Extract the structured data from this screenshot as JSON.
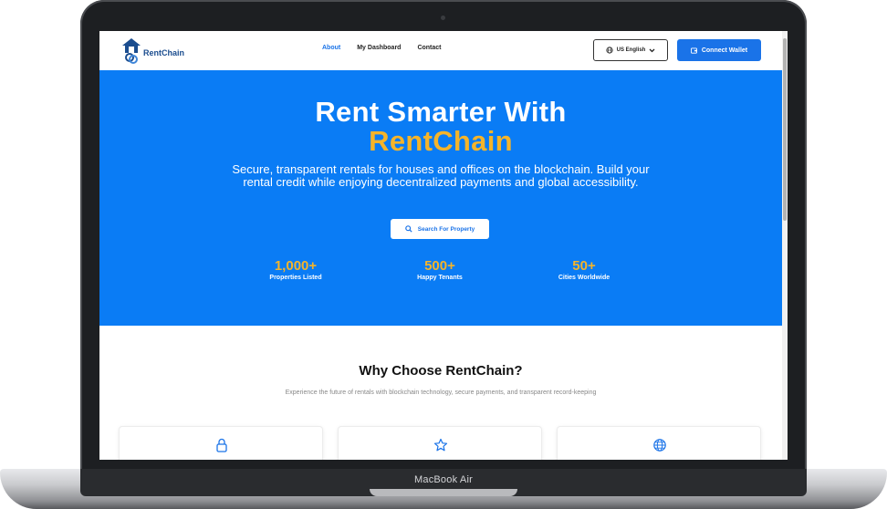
{
  "device": {
    "label": "MacBook Air"
  },
  "nav": {
    "logo_text": "RentChain",
    "links": [
      {
        "label": "About",
        "active": true
      },
      {
        "label": "My Dashboard",
        "active": false
      },
      {
        "label": "Contact",
        "active": false
      }
    ],
    "language": "US English",
    "connect_wallet": "Connect Wallet"
  },
  "hero": {
    "title_line1": "Rent Smarter With",
    "title_line2": "RentChain",
    "subtitle": "Secure, transparent rentals for houses and offices on the blockchain. Build your rental credit while enjoying decentralized payments and global accessibility.",
    "search_button": "Search For Property",
    "stats": [
      {
        "value": "1,000+",
        "label": "Properties Listed"
      },
      {
        "value": "500+",
        "label": "Happy Tenants"
      },
      {
        "value": "50+",
        "label": "Cities Worldwide"
      }
    ]
  },
  "why": {
    "title": "Why Choose RentChain?",
    "subtitle": "Experience the future of rentals with blockchain technology, secure payments, and transparent record-keeping",
    "cards": [
      {
        "icon": "lock-icon"
      },
      {
        "icon": "star-icon"
      },
      {
        "icon": "globe-icon"
      }
    ]
  },
  "colors": {
    "primary": "#0a7cf5",
    "accent": "#f5b42a",
    "button_blue": "#1a73e8"
  }
}
